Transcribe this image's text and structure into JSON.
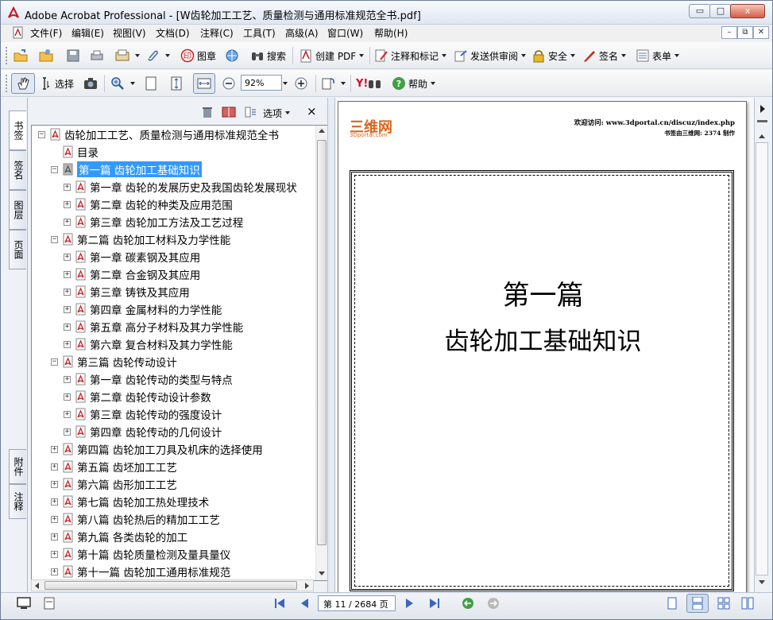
{
  "window": {
    "app": "Adobe Acrobat Professional",
    "title": "Adobe Acrobat Professional - [W齿轮加工工艺、质量检测与通用标准规范全书.pdf]",
    "min": "▭",
    "max": "□",
    "close": "x"
  },
  "menu": [
    "文件(F)",
    "编辑(E)",
    "视图(V)",
    "文档(D)",
    "注释(C)",
    "工具(T)",
    "高级(A)",
    "窗口(W)",
    "帮助(H)"
  ],
  "mdi": {
    "min": "–",
    "restore": "⧉",
    "close": "✕"
  },
  "toolbar1": {
    "stamp_label": "图章",
    "search_label": "搜索",
    "create_pdf_label": "创建 PDF",
    "comment_label": "注释和标记",
    "review_label": "发送供审阅",
    "security_label": "安全",
    "sign_label": "签名",
    "forms_label": "表单"
  },
  "toolbar2": {
    "select_label": "选择",
    "zoom_value": "92%",
    "help_label": "帮助",
    "yahoo_label": "Y!"
  },
  "left_tabs": [
    "书签",
    "签名",
    "图层",
    "页面",
    "附件",
    "注释"
  ],
  "nav_panel": {
    "options_label": "选项",
    "close": "×"
  },
  "tree": [
    {
      "label": "齿轮加工工艺、质量检测与通用标准规范全书",
      "level": 0,
      "exp": "−"
    },
    {
      "label": "目录",
      "level": 1,
      "exp": ""
    },
    {
      "label": "第一篇  齿轮加工基础知识",
      "level": 1,
      "exp": "−",
      "selected": true
    },
    {
      "label": "第一章  齿轮的发展历史及我国齿轮发展现状",
      "level": 2,
      "exp": "+"
    },
    {
      "label": "第二章  齿轮的种类及应用范围",
      "level": 2,
      "exp": "+"
    },
    {
      "label": "第三章  齿轮加工方法及工艺过程",
      "level": 2,
      "exp": "+"
    },
    {
      "label": "第二篇  齿轮加工材料及力学性能",
      "level": 1,
      "exp": "−"
    },
    {
      "label": "第一章  碳素钢及其应用",
      "level": 2,
      "exp": "+"
    },
    {
      "label": "第二章  合金钢及其应用",
      "level": 2,
      "exp": "+"
    },
    {
      "label": "第三章  铸铁及其应用",
      "level": 2,
      "exp": "+"
    },
    {
      "label": "第四章  金属材料的力学性能",
      "level": 2,
      "exp": "+"
    },
    {
      "label": "第五章  高分子材料及其力学性能",
      "level": 2,
      "exp": "+"
    },
    {
      "label": "第六章  复合材料及其力学性能",
      "level": 2,
      "exp": "+"
    },
    {
      "label": "第三篇  齿轮传动设计",
      "level": 1,
      "exp": "−"
    },
    {
      "label": "第一章  齿轮传动的类型与特点",
      "level": 2,
      "exp": "+"
    },
    {
      "label": "第二章  齿轮传动设计参数",
      "level": 2,
      "exp": "+"
    },
    {
      "label": "第三章  齿轮传动的强度设计",
      "level": 2,
      "exp": "+"
    },
    {
      "label": "第四章  齿轮传动的几何设计",
      "level": 2,
      "exp": "+"
    },
    {
      "label": "第四篇  齿轮加工刀具及机床的选择使用",
      "level": 1,
      "exp": "+"
    },
    {
      "label": "第五篇  齿坯加工工艺",
      "level": 1,
      "exp": "+"
    },
    {
      "label": "第六篇  齿形加工工艺",
      "level": 1,
      "exp": "+"
    },
    {
      "label": "第七篇  齿轮加工热处理技术",
      "level": 1,
      "exp": "+"
    },
    {
      "label": "第八篇  齿轮热后的精加工工艺",
      "level": 1,
      "exp": "+"
    },
    {
      "label": "第九篇  各类齿轮的加工",
      "level": 1,
      "exp": "+"
    },
    {
      "label": "第十篇  齿轮质量检测及量具量仪",
      "level": 1,
      "exp": "+"
    },
    {
      "label": "第十一篇  齿轮加工通用标准规范",
      "level": 1,
      "exp": "+"
    }
  ],
  "page": {
    "logo": "三维网",
    "logo_sub": "3Dportal.com",
    "header_line1": "欢迎访问: www.3dportal.cn/discuz/index.php",
    "header_line2": "书签由三维网: 2374  制作",
    "title1": "第一篇",
    "title2": "齿轮加工基础知识"
  },
  "status": {
    "page_display": "第 11 / 2684 页"
  },
  "colors": {
    "selection": "#3399ff",
    "accent": "#cc2222"
  }
}
